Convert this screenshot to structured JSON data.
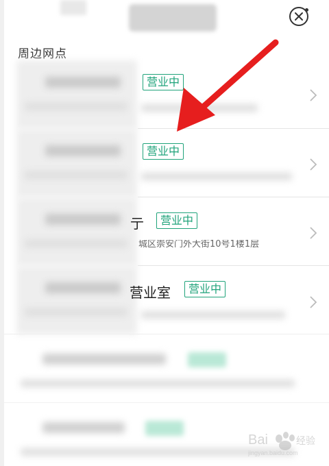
{
  "header": {
    "title_blurred": true,
    "close_icon": "close-circle-icon"
  },
  "section_title": "周边网点",
  "list": {
    "items": [
      {
        "status": "营业中",
        "name_blurred": true
      },
      {
        "status": "营业中",
        "name_blurred": true
      },
      {
        "name_suffix": "亍",
        "status": "营业中",
        "address_tail": "城区崇安门外大街10号1楼1层"
      },
      {
        "name_suffix": "营业室",
        "status": "营业中"
      },
      {
        "name_blurred": true
      },
      {
        "name_blurred": true
      }
    ]
  },
  "annotation": {
    "arrow_color": "#e61e1e"
  },
  "colors": {
    "status_green": "#1fa37a",
    "background": "#ffffff"
  },
  "watermark": {
    "text_top": "Bai",
    "text_side": "经验",
    "text_bottom": "jingyan.baidu.com"
  }
}
